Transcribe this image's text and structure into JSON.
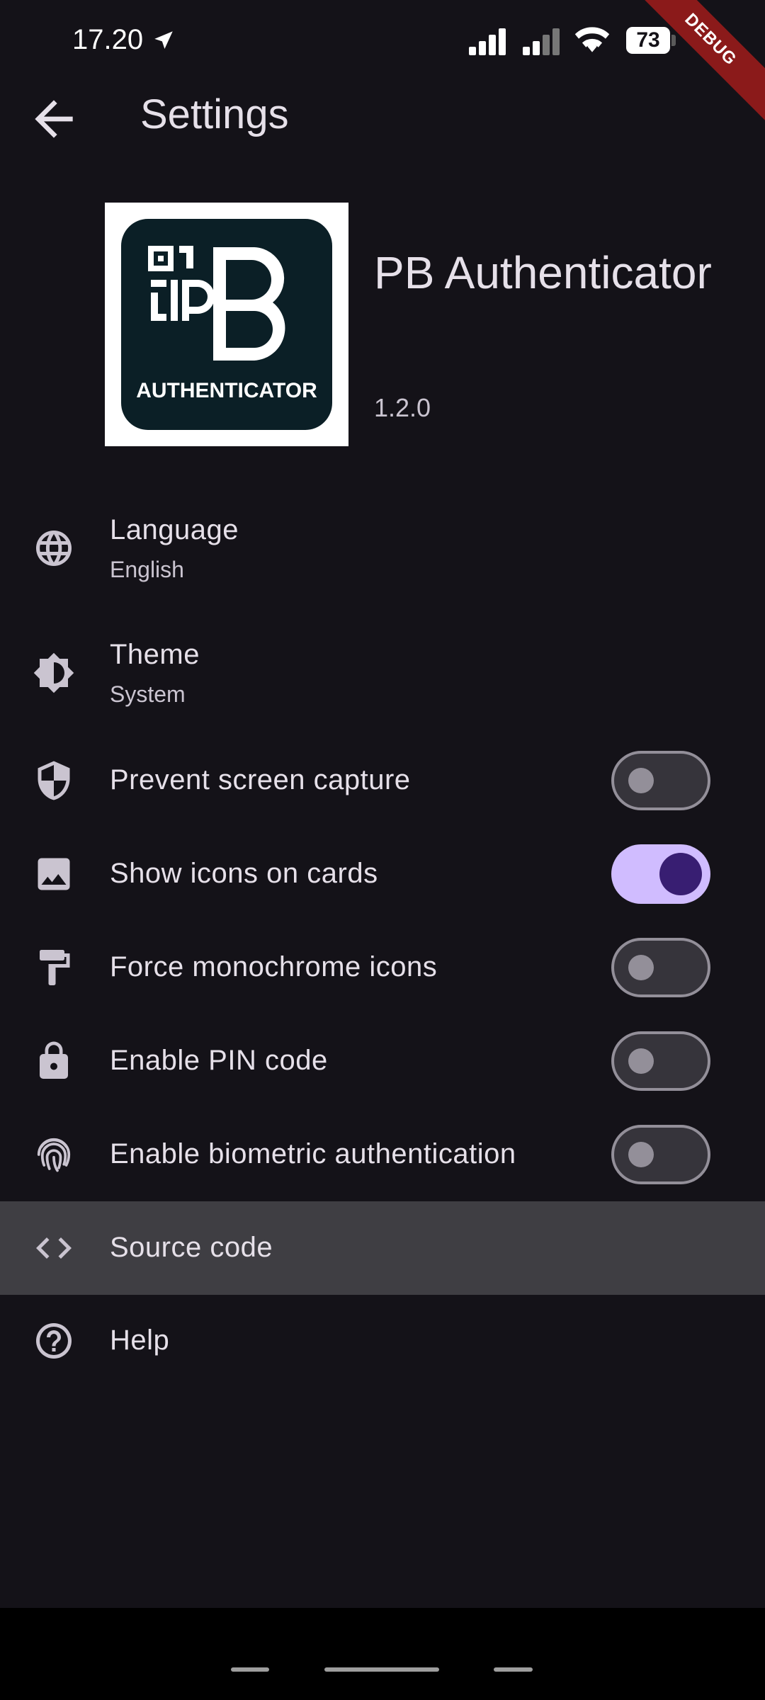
{
  "status_bar": {
    "time": "17.20",
    "battery": "73",
    "debug_banner": "DEBUG"
  },
  "app_bar": {
    "title": "Settings"
  },
  "about": {
    "logo_text": "AUTHENTICATOR",
    "app_name": "PB Authenticator",
    "version": "1.2.0"
  },
  "settings": {
    "language": {
      "label": "Language",
      "value": "English",
      "icon": "globe-icon"
    },
    "theme": {
      "label": "Theme",
      "value": "System",
      "icon": "brightness-icon"
    },
    "prevent_screen_capture": {
      "label": "Prevent screen capture",
      "enabled": false,
      "icon": "shield-icon"
    },
    "show_icons_on_cards": {
      "label": "Show icons on cards",
      "enabled": true,
      "icon": "image-icon"
    },
    "force_monochrome_icons": {
      "label": "Force monochrome icons",
      "enabled": false,
      "icon": "paint-roller-icon"
    },
    "enable_pin_code": {
      "label": "Enable PIN code",
      "enabled": false,
      "icon": "lock-icon"
    },
    "enable_biometric": {
      "label": "Enable biometric authentication",
      "enabled": false,
      "icon": "fingerprint-icon"
    },
    "source_code": {
      "label": "Source code",
      "icon": "code-icon"
    },
    "help": {
      "label": "Help",
      "icon": "help-icon"
    }
  },
  "colors": {
    "background": "#141218",
    "switch_on": "#D0BCFF",
    "switch_on_knob": "#381E72",
    "highlight_row": "#3f3e43"
  }
}
